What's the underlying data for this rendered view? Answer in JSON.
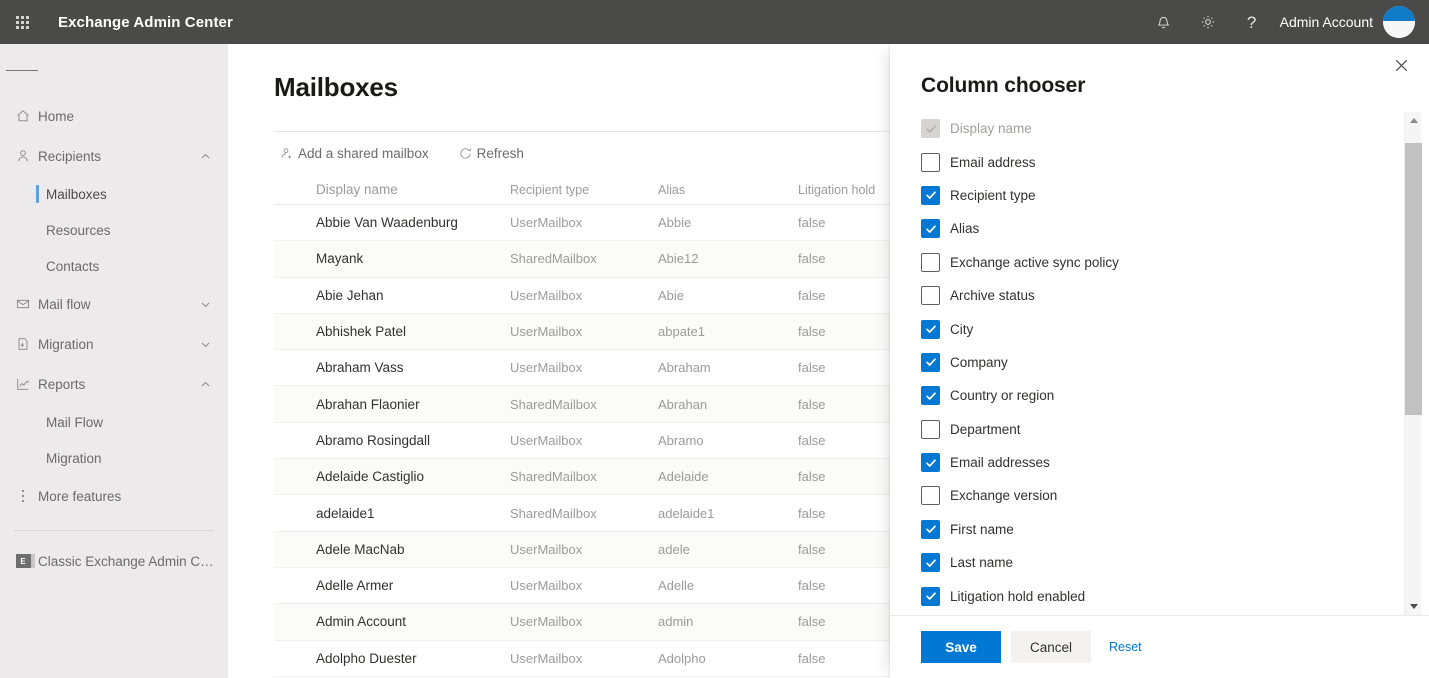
{
  "suite": {
    "waffle_label": "app-launcher",
    "title": "Exchange Admin Center",
    "notifications_icon": "bell-icon",
    "settings_icon": "gear-icon",
    "help_icon": "question-mark-icon",
    "user_name": "Admin Account",
    "accent": "#0078d4",
    "bar_color": "#4a4a48"
  },
  "sidebar": {
    "hamburger_label": "Collapse navigation",
    "items": [
      {
        "label": "Home",
        "icon": "home-icon",
        "type": "item",
        "expandable": false
      },
      {
        "label": "Recipients",
        "icon": "person-icon",
        "type": "item",
        "expandable": true,
        "expanded": true,
        "chevron": "chevron-up"
      },
      {
        "label": "Mailboxes",
        "type": "sub",
        "active": true
      },
      {
        "label": "Resources",
        "type": "sub",
        "active": false
      },
      {
        "label": "Contacts",
        "type": "sub",
        "active": false
      },
      {
        "label": "Mail flow",
        "icon": "envelope-icon",
        "type": "item",
        "expandable": true,
        "expanded": false,
        "chevron": "chevron-down"
      },
      {
        "label": "Migration",
        "icon": "migration-icon",
        "type": "item",
        "expandable": true,
        "expanded": false,
        "chevron": "chevron-down"
      },
      {
        "label": "Reports",
        "icon": "chart-icon",
        "type": "item",
        "expandable": true,
        "expanded": true,
        "chevron": "chevron-up"
      },
      {
        "label": "Mail Flow",
        "type": "sub",
        "active": false
      },
      {
        "label": "Migration",
        "type": "sub",
        "active": false
      },
      {
        "label": "More features",
        "icon": "ellipsis-icon",
        "type": "item",
        "expandable": false
      }
    ],
    "footer_link": {
      "label": "Classic Exchange Admin Cent...",
      "icon": "exchange-icon"
    }
  },
  "main": {
    "page_title": "Mailboxes",
    "toolbar": [
      {
        "label": "Add a shared mailbox",
        "icon": "add-person-icon"
      },
      {
        "label": "Refresh",
        "icon": "refresh-icon"
      }
    ],
    "table": {
      "columns": [
        "Display name",
        "Recipient type",
        "Alias",
        "Litigation hold"
      ],
      "rows": [
        {
          "display_name": "Abbie Van Waadenburg",
          "recipient_type": "UserMailbox",
          "alias": "Abbie",
          "litigation_hold": "false"
        },
        {
          "display_name": "Mayank",
          "recipient_type": "SharedMailbox",
          "alias": "Abie12",
          "litigation_hold": "false"
        },
        {
          "display_name": "Abie Jehan",
          "recipient_type": "UserMailbox",
          "alias": "Abie",
          "litigation_hold": "false"
        },
        {
          "display_name": "Abhishek Patel",
          "recipient_type": "UserMailbox",
          "alias": "abpate1",
          "litigation_hold": "false"
        },
        {
          "display_name": "Abraham Vass",
          "recipient_type": "UserMailbox",
          "alias": "Abraham",
          "litigation_hold": "false"
        },
        {
          "display_name": "Abrahan Flaonier",
          "recipient_type": "SharedMailbox",
          "alias": "Abrahan",
          "litigation_hold": "false"
        },
        {
          "display_name": "Abramo Rosingdall",
          "recipient_type": "UserMailbox",
          "alias": "Abramo",
          "litigation_hold": "false"
        },
        {
          "display_name": "Adelaide Castiglio",
          "recipient_type": "SharedMailbox",
          "alias": "Adelaide",
          "litigation_hold": "false"
        },
        {
          "display_name": "adelaide1",
          "recipient_type": "SharedMailbox",
          "alias": "adelaide1",
          "litigation_hold": "false"
        },
        {
          "display_name": "Adele MacNab",
          "recipient_type": "UserMailbox",
          "alias": "adele",
          "litigation_hold": "false"
        },
        {
          "display_name": "Adelle Armer",
          "recipient_type": "UserMailbox",
          "alias": "Adelle",
          "litigation_hold": "false"
        },
        {
          "display_name": "Admin Account",
          "recipient_type": "UserMailbox",
          "alias": "admin",
          "litigation_hold": "false"
        },
        {
          "display_name": "Adolpho Duester",
          "recipient_type": "UserMailbox",
          "alias": "Adolpho",
          "litigation_hold": "false"
        }
      ]
    }
  },
  "panel": {
    "title": "Column chooser",
    "close_icon": "close-icon",
    "options": [
      {
        "label": "Display name",
        "checked": true,
        "disabled": true
      },
      {
        "label": "Email address",
        "checked": false,
        "disabled": false
      },
      {
        "label": "Recipient type",
        "checked": true,
        "disabled": false
      },
      {
        "label": "Alias",
        "checked": true,
        "disabled": false
      },
      {
        "label": "Exchange active sync policy",
        "checked": false,
        "disabled": false
      },
      {
        "label": "Archive status",
        "checked": false,
        "disabled": false
      },
      {
        "label": "City",
        "checked": true,
        "disabled": false
      },
      {
        "label": "Company",
        "checked": true,
        "disabled": false
      },
      {
        "label": "Country or region",
        "checked": true,
        "disabled": false
      },
      {
        "label": "Department",
        "checked": false,
        "disabled": false
      },
      {
        "label": "Email addresses",
        "checked": true,
        "disabled": false
      },
      {
        "label": "Exchange version",
        "checked": false,
        "disabled": false
      },
      {
        "label": "First name",
        "checked": true,
        "disabled": false
      },
      {
        "label": "Last name",
        "checked": true,
        "disabled": false
      },
      {
        "label": "Litigation hold enabled",
        "checked": true,
        "disabled": false
      }
    ],
    "scrollbar": {
      "thumb_top_pct": 3,
      "thumb_height_pct": 58
    },
    "footer": {
      "save_label": "Save",
      "cancel_label": "Cancel",
      "reset_label": "Reset"
    }
  }
}
